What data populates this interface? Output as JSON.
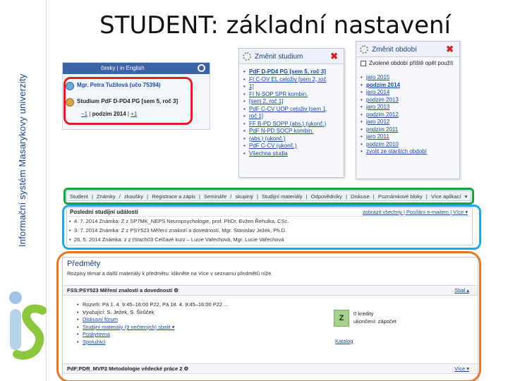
{
  "sidebar": {
    "text": "Informační systém Masarykovy univerzity"
  },
  "slide": {
    "title": "STUDENT: základní nastavení"
  },
  "login": {
    "lang": "česky | in English",
    "name": "Mgr. Petra Tužilová (učo 75394)",
    "study": "Studium PdF D-PD4 PG [sem 5, roč 3]",
    "prev": "−1",
    "period": "podzim 2014",
    "next": "+1"
  },
  "study_popup": {
    "title": "Změnit studium",
    "items": [
      "PdF D-PD4 PG [sem 5, roč 3]",
      "FI C-OV EL celoživ [sem 2, roč",
      "1]",
      "FI N-SOP SPR kombin.",
      "[sem 2, roč 1]",
      "PdF C-CV UOP celoživ [sem 1,",
      "roč 1]",
      "FF B-PD SOPP (abs.) (ukonč.)",
      "PdF N-PD SOCP kombin.",
      "(abs.) (ukonč.)",
      "PdF C-CV (ukonč.)",
      "Všechna studia"
    ]
  },
  "period_popup": {
    "title": "Změnit období",
    "checkbox": "Zvolené období příště opět použít",
    "items": [
      "jaro 2015",
      "podzim 2014",
      "jaro 2014",
      "podzim 2013",
      "jaro 2013",
      "podzim 2012",
      "jaro 2012",
      "podzim 2011",
      "jaro 2011",
      "podzim 2010",
      "zvolit ze starších období"
    ]
  },
  "navbar": {
    "items": [
      "Student",
      "|",
      "Známky",
      "/",
      "zkoušky",
      "|",
      "Registrace a zápis",
      "|",
      "Semináře",
      "/",
      "skupiny",
      "|",
      "Studijní materiály",
      "|",
      "Odpovědníky",
      "|",
      "Diskuse",
      "|",
      "Poznámkové bloky",
      "|",
      "Více aplikací",
      "▾"
    ]
  },
  "events": {
    "title": "Poslední studijní události",
    "links": "zobrazit všechny | Posílání e-mailem | Více ▾",
    "rows": [
      "4. 7. 2014 Známka: Z z SP7MK_NEPS Neuropsychologie, prof. PhDr. Evžen Řehulka, CSc.",
      "3. 7. 2014 Známka: Z z PSY523 Měření znalostí a dovedností, Mgr. Stanislav Ježek, Ph.D.",
      "26. 5. 2014 Známka: z z IStach03 Celčavé kurz – Lucie Vařechová, Mgr. Lucie Vařechová"
    ]
  },
  "courses": {
    "title": "Předměty",
    "note": "Rozpisy témat a další materiály k předmětu: klikněte na Více v seznamu předmětů níže.",
    "course1": {
      "head": "FSS:PSY523 Měření znalostí a dovedností ⚙",
      "right": "Sbal ▴",
      "items": [
        "Rozvrh: Pá 1. 4. 9:45–16:00 P22, Pá 18. 4. 9:45–16:00 P22 ...",
        "Vyučující: S. Ježek, S. Širůček",
        "Diskusní fórum",
        "Studijní materiály (9 nečtených) sbalit ▾",
        "Poskytovna",
        "Spolužáci"
      ],
      "grade": "Z",
      "grade_info1": "0 kredity",
      "grade_info2": "ukončení: zápočet",
      "catalog": "Katalog"
    },
    "course2": {
      "head": "PdF:PDR_MVP2 Metodologie vědecké práce 2 ⚙",
      "right": "Více ▾"
    }
  },
  "colors": {
    "red_highlight": "#e02020",
    "green_highlight": "#1ba23c",
    "blue_highlight": "#27a6dc",
    "orange_highlight": "#e2782a",
    "brand_blue": "#1f3f8f"
  }
}
